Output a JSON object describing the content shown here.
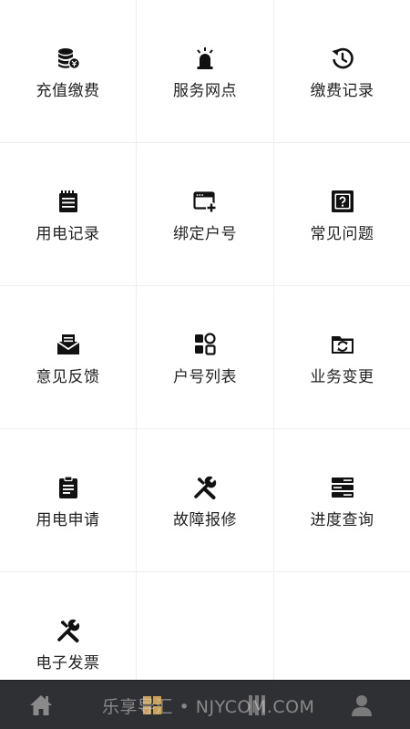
{
  "menu": {
    "items": [
      {
        "label": "充值缴费",
        "icon": "database-coins-icon"
      },
      {
        "label": "服务网点",
        "icon": "siren-beacon-icon"
      },
      {
        "label": "缴费记录",
        "icon": "history-clock-icon"
      },
      {
        "label": "用电记录",
        "icon": "notepad-list-icon"
      },
      {
        "label": "绑定户号",
        "icon": "window-add-icon"
      },
      {
        "label": "常见问题",
        "icon": "question-box-icon"
      },
      {
        "label": "意见反馈",
        "icon": "inbox-mail-icon"
      },
      {
        "label": "户号列表",
        "icon": "apps-grid-icon"
      },
      {
        "label": "业务变更",
        "icon": "folder-sync-icon"
      },
      {
        "label": "用电申请",
        "icon": "clipboard-list-icon"
      },
      {
        "label": "故障报修",
        "icon": "tools-repair-icon"
      },
      {
        "label": "进度查询",
        "icon": "server-stack-icon"
      },
      {
        "label": "电子发票",
        "icon": "tools-repair-icon"
      }
    ]
  },
  "tabbar": {
    "tabs": [
      {
        "icon": "home-icon",
        "active": true
      },
      {
        "icon": "grid-icon",
        "active": false
      },
      {
        "icon": "bars-icon",
        "active": false
      },
      {
        "icon": "user-icon",
        "active": false
      }
    ],
    "active_color": "#8a8a8a",
    "grid_icon_color": "#c9a35a",
    "inactive_color": "#7a7a7a"
  },
  "watermark": {
    "text": "乐享导汇 • NJYCOM.COM"
  },
  "colors": {
    "background": "#ffffff",
    "divider": "#eeeeee",
    "label": "#222222",
    "icon": "#111111",
    "tabbar_bg": "#2f3033"
  }
}
